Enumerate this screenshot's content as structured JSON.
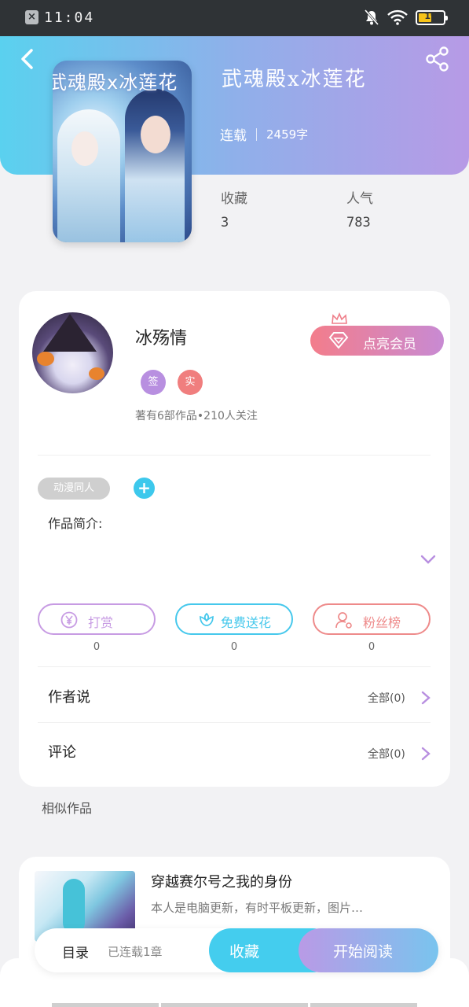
{
  "status_bar": {
    "time": "11:04",
    "battery": "19"
  },
  "book": {
    "title": "武魂殿x冰莲花",
    "cover_text": "武魂殿x冰莲花",
    "status": "连载",
    "word_count": "2459字",
    "stats": [
      {
        "label": "收藏",
        "value": "3"
      },
      {
        "label": "人气",
        "value": "783"
      }
    ]
  },
  "author": {
    "name": "冰殇情",
    "badges": [
      "签",
      "实"
    ],
    "info": "著有6部作品•210人关注",
    "vip_button": "点亮会员"
  },
  "tags": {
    "genre": "动漫同人",
    "add": "+"
  },
  "intro_label": "作品简介:",
  "actions": [
    {
      "label": "打赏",
      "count": "0",
      "color": "#c79be3"
    },
    {
      "label": "免费送花",
      "count": "0",
      "color": "#46c8ec"
    },
    {
      "label": "粉丝榜",
      "count": "0",
      "color": "#ee8a8a"
    }
  ],
  "rows": [
    {
      "label": "作者说",
      "right": "全部(0)"
    },
    {
      "label": "评论",
      "right": "全部(0)"
    }
  ],
  "similar": {
    "section_label": "相似作品",
    "items": [
      {
        "title": "穿越赛尔号之我的身份",
        "desc": "本人是电脑更新，有时平板更新，图片…"
      }
    ]
  },
  "bottom_bar": {
    "toc": "目录",
    "chapters": "已连载1章",
    "favorite": "收藏",
    "read": "开始阅读"
  },
  "colors": {
    "accent_blue": "#44cdee",
    "accent_purple": "#b99ae6",
    "badge_sign": "#b88fe0",
    "badge_real": "#f07e7e"
  }
}
